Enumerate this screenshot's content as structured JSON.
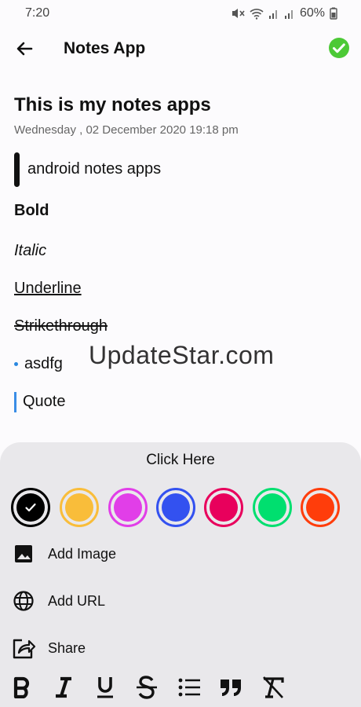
{
  "status_bar": {
    "time": "7:20",
    "battery": "60%"
  },
  "header": {
    "title": "Notes App",
    "back_icon": "arrow-left-icon",
    "save_icon": "check-circle-icon",
    "save_color": "#4cc936"
  },
  "note": {
    "title": "This is my notes apps",
    "date": "Wednesday , 02 December 2020 19:18 pm",
    "lines": {
      "plain": "android notes apps",
      "bold": "Bold",
      "italic": "Italic",
      "underline": "Underline",
      "strikethrough": "Strikethrough",
      "bullet": "asdfg",
      "quote": "Quote"
    }
  },
  "watermark": "UpdateStar.com",
  "sheet": {
    "title": "Click Here",
    "colors": [
      {
        "name": "black",
        "hex": "#000000",
        "selected": true
      },
      {
        "name": "yellow",
        "hex": "#f9bd3a",
        "selected": false
      },
      {
        "name": "magenta",
        "hex": "#e13ee8",
        "selected": false
      },
      {
        "name": "blue",
        "hex": "#3351f0",
        "selected": false
      },
      {
        "name": "crimson",
        "hex": "#e8005c",
        "selected": false
      },
      {
        "name": "green",
        "hex": "#00df6f",
        "selected": false
      },
      {
        "name": "orange-red",
        "hex": "#ff3d0b",
        "selected": false
      }
    ],
    "menu": [
      {
        "label": "Add Image",
        "icon": "image-icon"
      },
      {
        "label": "Add URL",
        "icon": "globe-icon"
      },
      {
        "label": "Share",
        "icon": "share-icon"
      }
    ],
    "format_tools": [
      "bold-icon",
      "italic-icon",
      "underline-icon",
      "strikethrough-icon",
      "bullet-list-icon",
      "quote-icon",
      "clear-format-icon"
    ]
  }
}
